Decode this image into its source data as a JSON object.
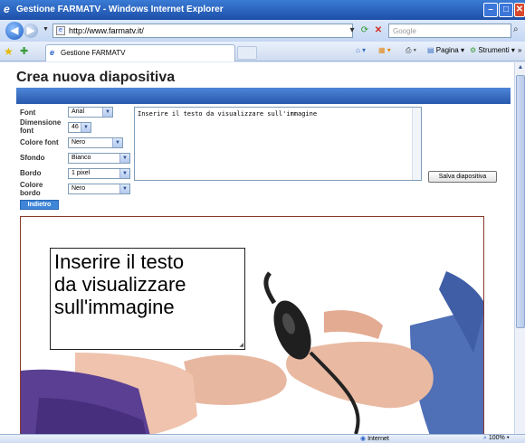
{
  "window": {
    "title": "Gestione FARMATV - Windows Internet Explorer",
    "min_glyph": "–",
    "max_glyph": "□",
    "close_glyph": "✕"
  },
  "address": {
    "url": "http://www.farmatv.it/",
    "search_placeholder": "Google"
  },
  "tabbar": {
    "tab_title": "Gestione FARMATV",
    "page_menu": "Pagina",
    "tools_menu": "Strumenti",
    "more": "»"
  },
  "page": {
    "title": "Crea nuova diapositiva",
    "accent_color": "#2859ad"
  },
  "form": {
    "font_label": "Font",
    "font_value": "Arial",
    "size_label": "Dimensione font",
    "size_value": "46",
    "color_label": "Colore font",
    "color_value": "Nero",
    "bg_label": "Sfondo",
    "bg_value": "Bianco",
    "border_label": "Bordo",
    "border_value": "1 pixel",
    "border_color_label": "Colore bordo",
    "border_color_value": "Nero",
    "text_value": "Inserire il testo da visualizzare sull'immagine",
    "save_button": "Salva diapositiva",
    "back_button": "Indietro"
  },
  "preview": {
    "overlay_text": "Inserire il testo da visualizzare sull'immagine"
  },
  "statusbar": {
    "zone": "Internet",
    "zoom": "100%"
  },
  "icons": [
    "ie-icon",
    "back-arrow-icon",
    "forward-arrow-icon",
    "page-icon",
    "refresh-icon",
    "stop-icon",
    "search-icon",
    "favorites-star-icon",
    "add-favorites-icon",
    "home-icon",
    "feeds-icon",
    "print-icon",
    "page-menu-icon",
    "tools-menu-icon",
    "globe-icon",
    "zoom-icon"
  ]
}
